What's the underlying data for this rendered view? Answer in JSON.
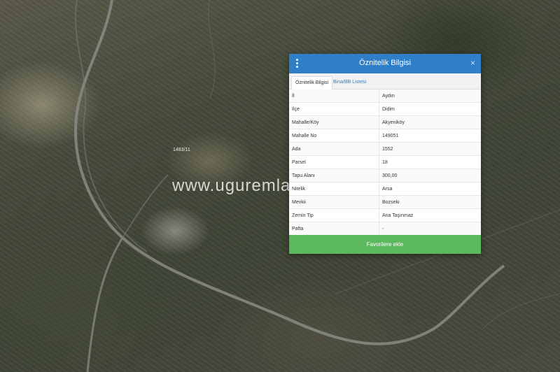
{
  "map": {
    "label": "1483/11",
    "watermark": "www.uguremlak.com"
  },
  "panel": {
    "title": "Öznitelik Bilgisi",
    "close_icon": "×",
    "menu_icon": "kebab-menu-icon",
    "tabs": [
      {
        "label": "Öznitelik Bilgisi",
        "active": true
      },
      {
        "label": "Bina/BB Listesi",
        "active": false
      }
    ],
    "rows": [
      {
        "key": "İl",
        "value": "Aydın"
      },
      {
        "key": "İlçe",
        "value": "Didim"
      },
      {
        "key": "Mahalle/Köy",
        "value": "Akyeniköy"
      },
      {
        "key": "Mahalle No",
        "value": "149051"
      },
      {
        "key": "Ada",
        "value": "1552"
      },
      {
        "key": "Parsel",
        "value": "18"
      },
      {
        "key": "Tapu Alanı",
        "value": "300,00"
      },
      {
        "key": "Nitelik",
        "value": "Arsa"
      },
      {
        "key": "Mevkii",
        "value": "Bozseki"
      },
      {
        "key": "Zemin Tip",
        "value": "Ana Taşınmaz"
      },
      {
        "key": "Pafta",
        "value": "-"
      }
    ],
    "favorite_button": "Favorilere ekle"
  },
  "colors": {
    "header": "#2f7fc8",
    "button": "#5cb85c"
  }
}
